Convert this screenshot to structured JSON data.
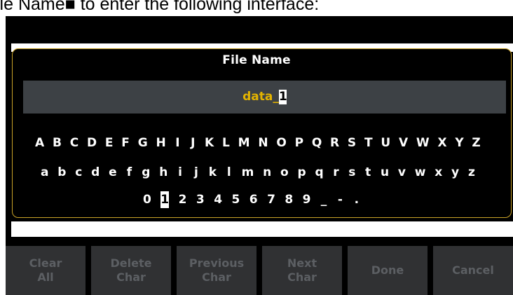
{
  "caption": "ile Name■ to enter the following interface:",
  "dialog": {
    "title": "File Name",
    "filename_prefix": "data_",
    "filename_cursor": "1"
  },
  "keyboard": {
    "uppercase": [
      "A",
      "B",
      "C",
      "D",
      "E",
      "F",
      "G",
      "H",
      "I",
      "J",
      "K",
      "L",
      "M",
      "N",
      "O",
      "P",
      "Q",
      "R",
      "S",
      "T",
      "U",
      "V",
      "W",
      "X",
      "Y",
      "Z"
    ],
    "lowercase": [
      "a",
      "b",
      "c",
      "d",
      "e",
      "f",
      "g",
      "h",
      "i",
      "j",
      "k",
      "l",
      "m",
      "n",
      "o",
      "p",
      "q",
      "r",
      "s",
      "t",
      "u",
      "v",
      "w",
      "x",
      "y",
      "z"
    ],
    "digits": [
      "0",
      "1",
      "2",
      "3",
      "4",
      "5",
      "6",
      "7",
      "8",
      "9",
      "_",
      "-",
      "."
    ],
    "selected_key": "1"
  },
  "softkeys": [
    {
      "id": "clear-all",
      "label": "Clear\nAll"
    },
    {
      "id": "delete-char",
      "label": "Delete\nChar"
    },
    {
      "id": "previous-char",
      "label": "Previous\nChar"
    },
    {
      "id": "next-char",
      "label": "Next\nChar"
    },
    {
      "id": "done",
      "label": "Done"
    },
    {
      "id": "cancel",
      "label": "Cancel"
    }
  ],
  "colors": {
    "filename_text": "#e3b300",
    "dialog_border": "#c9a227",
    "softkey_bg": "#303133",
    "softkey_text_disabled": "#5c5f63"
  }
}
